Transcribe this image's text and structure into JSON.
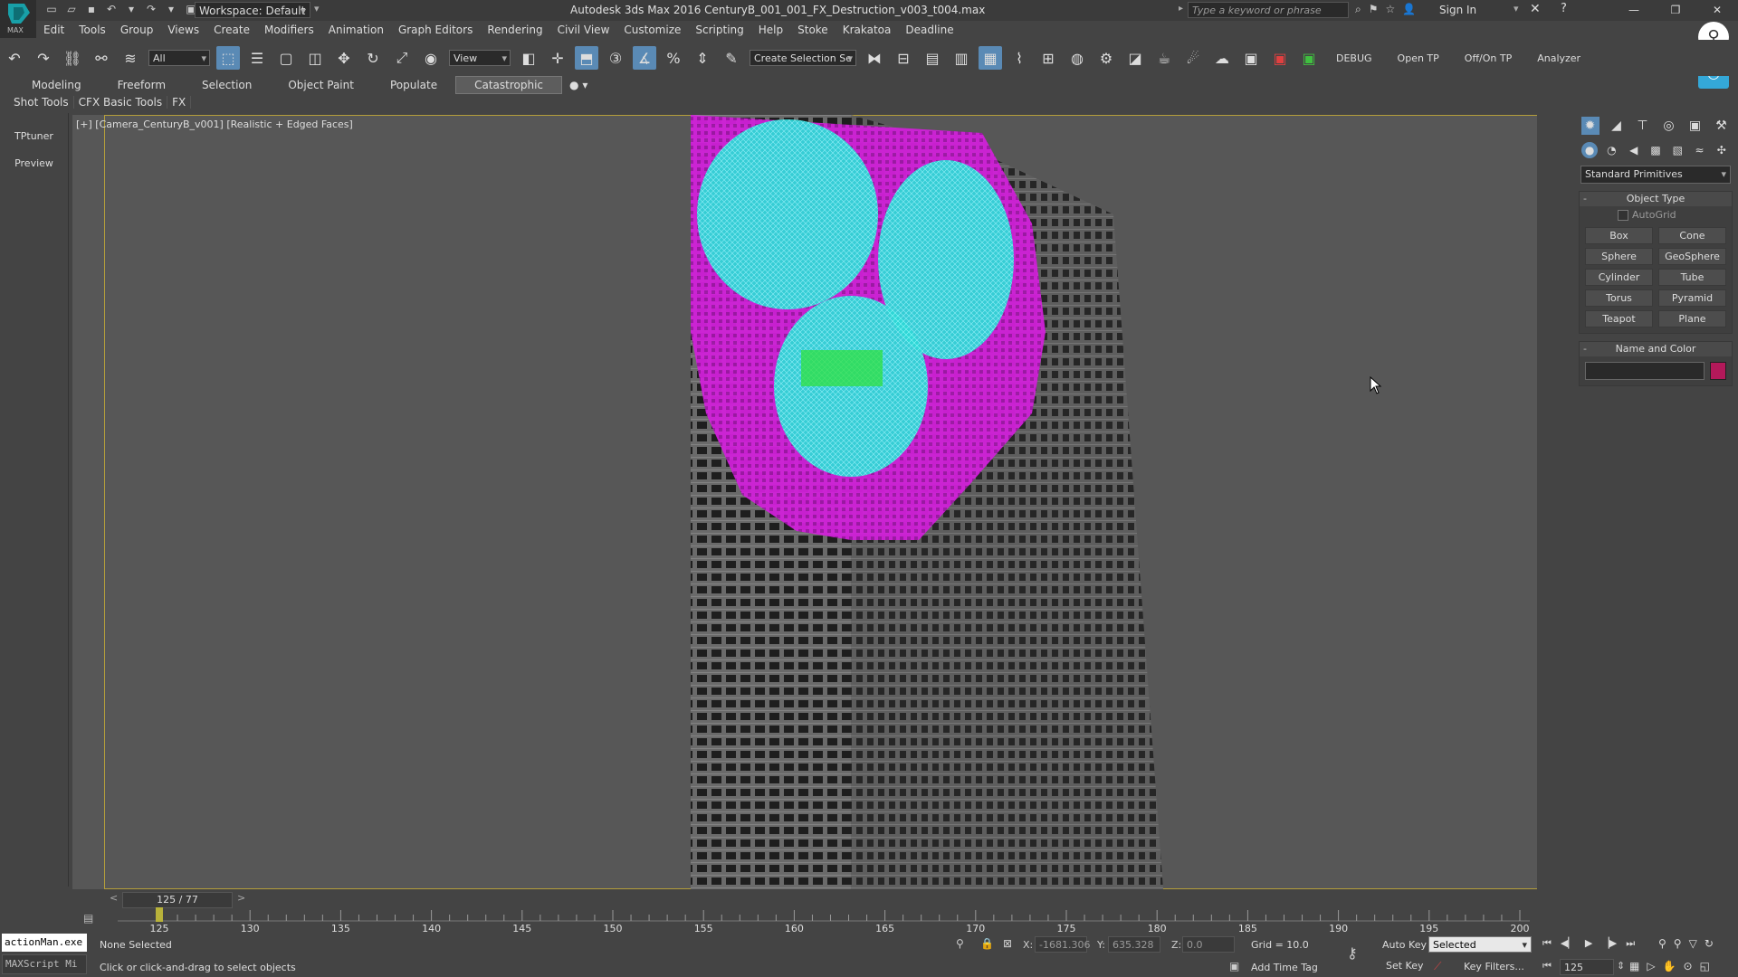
{
  "titlebar": {
    "logo_text": "MAX",
    "workspace": "Workspace: Default",
    "title": "Autodesk 3ds Max 2016    CenturyB_001_001_FX_Destruction_v003_t004.max",
    "search_placeholder": "Type a keyword or phrase",
    "sign_in": "Sign In"
  },
  "menu": [
    "Edit",
    "Tools",
    "Group",
    "Views",
    "Create",
    "Modifiers",
    "Animation",
    "Graph Editors",
    "Rendering",
    "Civil View",
    "Customize",
    "Scripting",
    "Help",
    "Stoke",
    "Krakatoa",
    "Deadline"
  ],
  "toolbar": {
    "selection_filter": "All",
    "ref_coord": "View",
    "named_selection": "Create Selection Se",
    "text_buttons": [
      "DEBUG",
      "Open TP",
      "Off/On TP",
      "Analyzer"
    ]
  },
  "ribbon_tabs": [
    "Modeling",
    "Freeform",
    "Selection",
    "Object Paint",
    "Populate",
    "Catastrophic"
  ],
  "sub_tabs": [
    "Shot Tools",
    "CFX Basic Tools",
    "FX"
  ],
  "left_panel": [
    "TPtuner",
    "Preview"
  ],
  "viewport": {
    "label": "[+] [Camera_CenturyB_v001] [Realistic + Edged Faces]"
  },
  "command_panel": {
    "category": "Standard Primitives",
    "object_type_title": "Object Type",
    "autogrid": "AutoGrid",
    "buttons": [
      "Box",
      "Cone",
      "Sphere",
      "GeoSphere",
      "Cylinder",
      "Tube",
      "Torus",
      "Pyramid",
      "Teapot",
      "Plane"
    ],
    "name_color_title": "Name and Color",
    "color": "#b3195a"
  },
  "timeline": {
    "slider": "125 / 77",
    "ticks": [
      "125",
      "130",
      "135",
      "140",
      "145",
      "150",
      "155",
      "160",
      "165",
      "170",
      "175",
      "180",
      "185",
      "190",
      "195",
      "200"
    ]
  },
  "status": {
    "maxscript_line1": "actionMan.exe",
    "maxscript_line2": "MAXScript Mi",
    "selection": "None Selected",
    "prompt": "Click or click-and-drag to select objects",
    "x_label": "X:",
    "x_value": "-1681.306",
    "y_label": "Y:",
    "y_value": "635.328",
    "z_label": "Z:",
    "z_value": "0.0",
    "grid": "Grid = 10.0",
    "add_time_tag": "Add Time Tag",
    "auto_key": "Auto Key",
    "set_key": "Set Key",
    "selected_combo": "Selected",
    "key_filters": "Key Filters...",
    "frame": "125"
  }
}
